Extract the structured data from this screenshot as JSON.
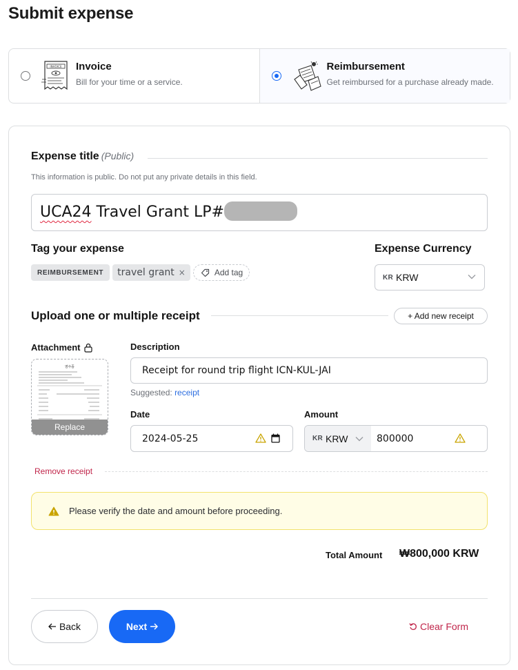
{
  "page": {
    "title": "Submit expense"
  },
  "expense_types": [
    {
      "title": "Invoice",
      "description": "Bill for your time or a service.",
      "selected": false,
      "illustration_text": "INVOICE"
    },
    {
      "title": "Reimbursement",
      "description": "Get reimbursed for a purchase already made.",
      "selected": true
    }
  ],
  "expense_title": {
    "label": "Expense title",
    "label_note": "(Public)",
    "help": "This information is public. Do not put any private details in this field.",
    "value_misspelled": "UCA24",
    "value_rest": " Travel Grant LP#"
  },
  "tags": {
    "label": "Tag your expense",
    "items": [
      "REIMBURSEMENT",
      "travel grant"
    ],
    "remove_glyph": "×",
    "add_label": "Add tag"
  },
  "currency": {
    "label": "Expense Currency",
    "code_prefix": "KR",
    "value": "KRW"
  },
  "receipts": {
    "label": "Upload one or multiple receipt",
    "add_button": "+ Add new receipt",
    "attachment_label": "Attachment",
    "replace_label": "Replace",
    "receipt_header": "영수증",
    "description_label": "Description",
    "description_value": "Receipt for round trip flight ICN-KUL-JAI",
    "suggested_prefix": "Suggested:",
    "suggested_value": "receipt",
    "date_label": "Date",
    "date_value": "2024-05-25",
    "amount_label": "Amount",
    "amount_currency_prefix": "KR",
    "amount_currency": "KRW",
    "amount_value": "800000",
    "remove_label": "Remove receipt"
  },
  "alert": {
    "text": "Please verify the date and amount before proceeding."
  },
  "total": {
    "label": "Total Amount",
    "value": "₩800,000 KRW"
  },
  "footer": {
    "back": "Back",
    "next": "Next",
    "clear": "Clear Form"
  },
  "colors": {
    "primary": "#1869f5",
    "danger": "#c0254a",
    "warning_bg": "#fffde6",
    "warning_border": "#f2e26b",
    "warning_icon": "#c9a400"
  }
}
